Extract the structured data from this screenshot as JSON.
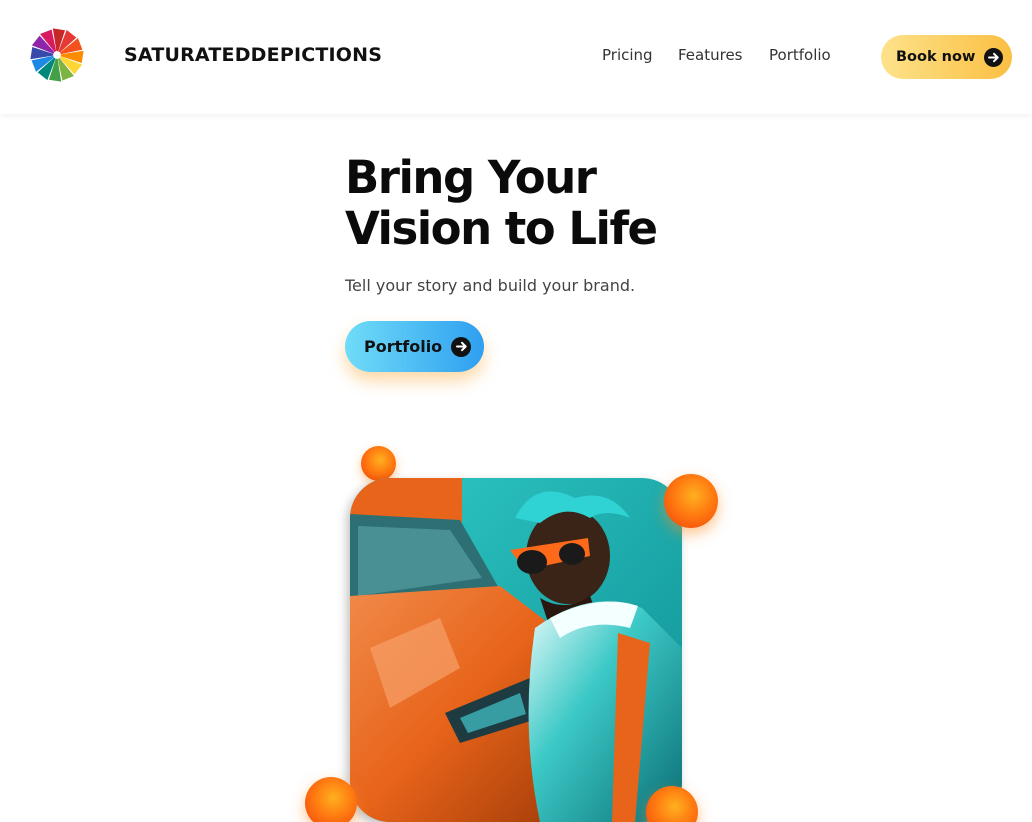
{
  "header": {
    "brand": "SATURATEDDEPICTIONS",
    "logo_icon": "rainbow-pinwheel-icon",
    "nav": [
      {
        "label": "Pricing"
      },
      {
        "label": "Features"
      },
      {
        "label": "Portfolio"
      }
    ],
    "cta_label": "Book now",
    "cta_icon": "arrow-right-circle-icon"
  },
  "hero": {
    "title_line1": "Bring Your",
    "title_line2": "Vision to Life",
    "subtitle": "Tell your story and build your brand.",
    "button_label": "Portfolio",
    "button_icon": "arrow-right-circle-icon"
  },
  "colors": {
    "cta_gradient": [
      "#fde28a",
      "#fbbf43"
    ],
    "portfolio_gradient": [
      "#6fdcf7",
      "#2f9ff0"
    ],
    "bubble": "#ff7a10",
    "photo_teal": "#1fb3b4",
    "photo_orange": "#e8641a"
  }
}
